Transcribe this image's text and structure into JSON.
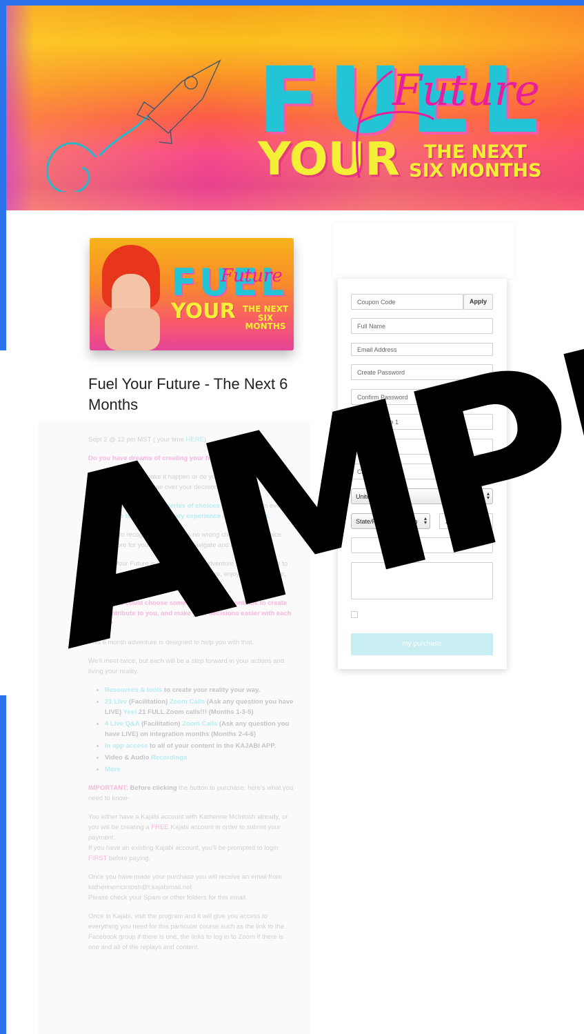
{
  "banner": {
    "fuel": "FUEL",
    "your": "YOUR",
    "next_line1": "THE NEXT",
    "next_line2": "SIX MONTHS",
    "script": "Future"
  },
  "product": {
    "card_fuel": "FUEL",
    "card_your": "YOUR",
    "card_next_line1": "THE NEXT",
    "card_next_line2": "SIX MONTHS",
    "card_script": "Future",
    "title": "Fuel Your Future - The Next 6 Months"
  },
  "description": {
    "p1_prefix": "Sept 2 @ 12 pm MST ( your time ",
    "p1_link": "HERE",
    "p1_suffix": ")",
    "p2": "Do you have dreams of creating your future?",
    "p3": "Do you trust you to make it happen or do you make excuses, procrastinate, or ruminate over your decisions?",
    "p4_a": "Creation is a never ending ",
    "p4_b": "series of choices",
    "p4_c": " that when taken every day, ",
    "p4_d": "add up to an extraordinary experience of possibilities.",
    "p5": "You begin to recognize that there is no wrong choice. Every choice creates more for you to continue to navigate and explore.",
    "p6": "Creating Your Future is like going on an adventure. You don't have to get it right, you go on an adventure to explore, enjoy the experience, and take in the possibilities.",
    "p7": "What if you could choose something that will continue to create you, contribute to you, and make your decisions easier with each choice?",
    "p8": "This 6 month adventure is designed to help you with that.",
    "p9": "We'll meet twice, but each will be a step forward in your actions and living your reality.",
    "list": [
      {
        "a": "Resources & tools",
        "b": " to create your reality your way."
      },
      {
        "a": "21 Live",
        "b": " (Facilitation) ",
        "c": "Zoom Calls",
        "d": " (Ask any question you have LIVE) ",
        "e": "Yes!",
        "f": " 21 FULL Zoom calls!!! (Months 1-3-5)"
      },
      {
        "a": "4 Live Q&A",
        "b": " (Facilitation) ",
        "c": "Zoom Calls",
        "d": " (Ask any question you have LIVE) on integration months (Months 2-4-6)"
      },
      {
        "a": "In app access",
        "b": " to all of your content in the KAJABI APP."
      },
      {
        "a": "Video & Audio ",
        "b": "Recordings"
      },
      {
        "a": "More"
      }
    ],
    "imp_a": "IMPORTANT:",
    "imp_b": " Before clicking",
    "imp_c": " the button to purchase, here's what you need to know-",
    "p10_a": "You either have a Kajabi account with Katherine McIntosh already, or you will be creating a ",
    "p10_b": "FREE",
    "p10_c": " Kajabi account in order to submit your payment.",
    "p10_d": "If you have an existing Kajabi account, you'll be prompted to login ",
    "p10_e": "FIRST",
    "p10_f": " before paying.",
    "p11_a": "Once you have made your purchase you will receive an email from katherinemcintosh@t.kajabimail.net",
    "p11_b": "Please check your Spam or other folders for this email.",
    "p12": "Once in Kajabi, visit the program and it will give you access to everything you need for this particular course such as the link to the Facebook group if there is one, the links to log in to Zoom if there is one and all of the replays and content."
  },
  "checkout": {
    "coupon_placeholder": "Coupon Code",
    "apply_label": "Apply",
    "full_name": "Full Name",
    "email": "Email Address",
    "create_password": "Create Password",
    "confirm_password": "Confirm Password",
    "address1": "Address Line 1",
    "apt": "Apt, Suite, Etc",
    "city": "City",
    "country": "United States",
    "state": "State/Province/Region",
    "zip": "Zip/Postal Cod",
    "buy_label": "my purchase"
  },
  "watermark": "AMPL"
}
